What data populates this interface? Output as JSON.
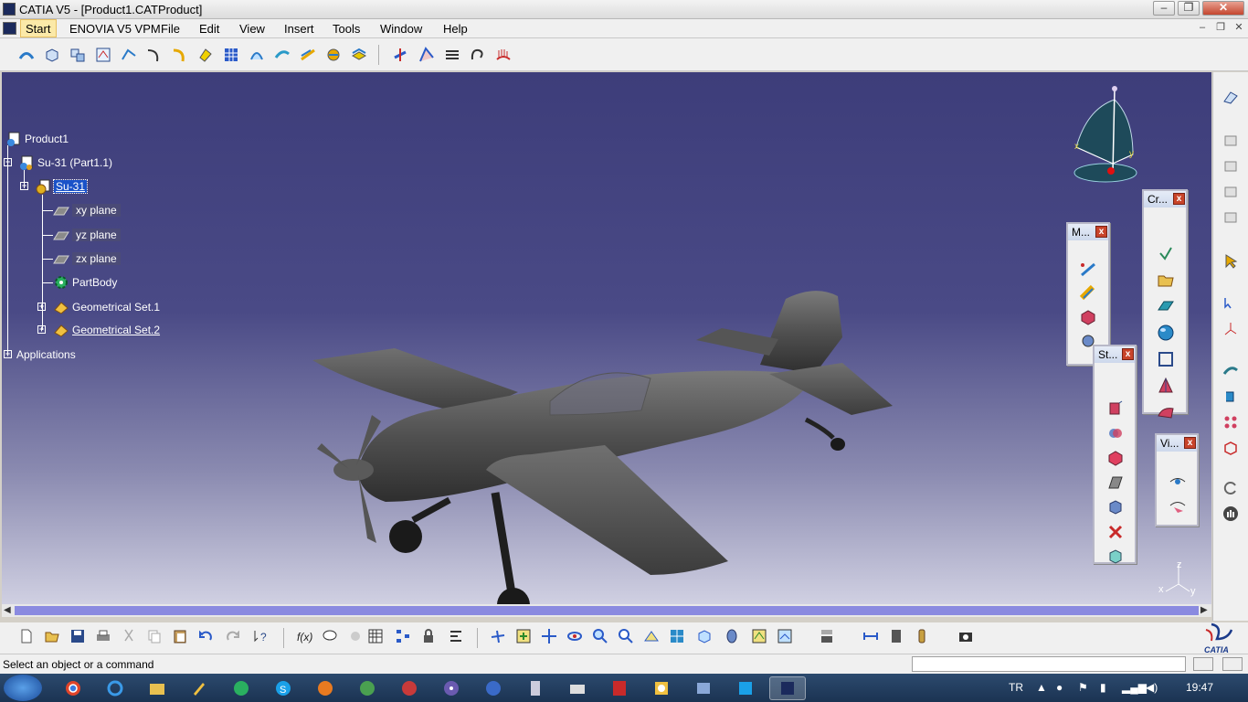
{
  "window": {
    "title": "CATIA V5 - [Product1.CATProduct]",
    "minimize": "–",
    "maximize": "❐",
    "close": "✕"
  },
  "menu": {
    "items": [
      "Start",
      "ENOVIA V5 VPM",
      "File",
      "Edit",
      "View",
      "Insert",
      "Tools",
      "Window",
      "Help"
    ],
    "mdi_minimize": "–",
    "mdi_restore": "❐",
    "mdi_close": "✕"
  },
  "tree": {
    "root": "Product1",
    "part": "Su-31 (Part1.1)",
    "part_name": "Su-31",
    "xy_plane": "xy plane",
    "yz_plane": "yz plane",
    "zx_plane": "zx plane",
    "partbody": "PartBody",
    "geo1": "Geometrical Set.1",
    "geo2": "Geometrical Set.2",
    "applications": "Applications"
  },
  "palettes": {
    "measure": "M...",
    "create": "Cr...",
    "standard": "St...",
    "view": "Vi...",
    "close": "x"
  },
  "axis": {
    "x": "x",
    "y": "y",
    "z": "z"
  },
  "status": {
    "message": "Select an object or a command"
  },
  "taskbar": {
    "language": "TR",
    "time": "19:47"
  },
  "brand": {
    "catia": "CATIA"
  },
  "colors": {
    "accent": "#1a52c8",
    "viewport_top": "#3d3d7a",
    "viewport_bottom": "#d0d0e2",
    "scroll_thumb": "#8a8ae0",
    "plane_model": "#5a5a5a"
  }
}
